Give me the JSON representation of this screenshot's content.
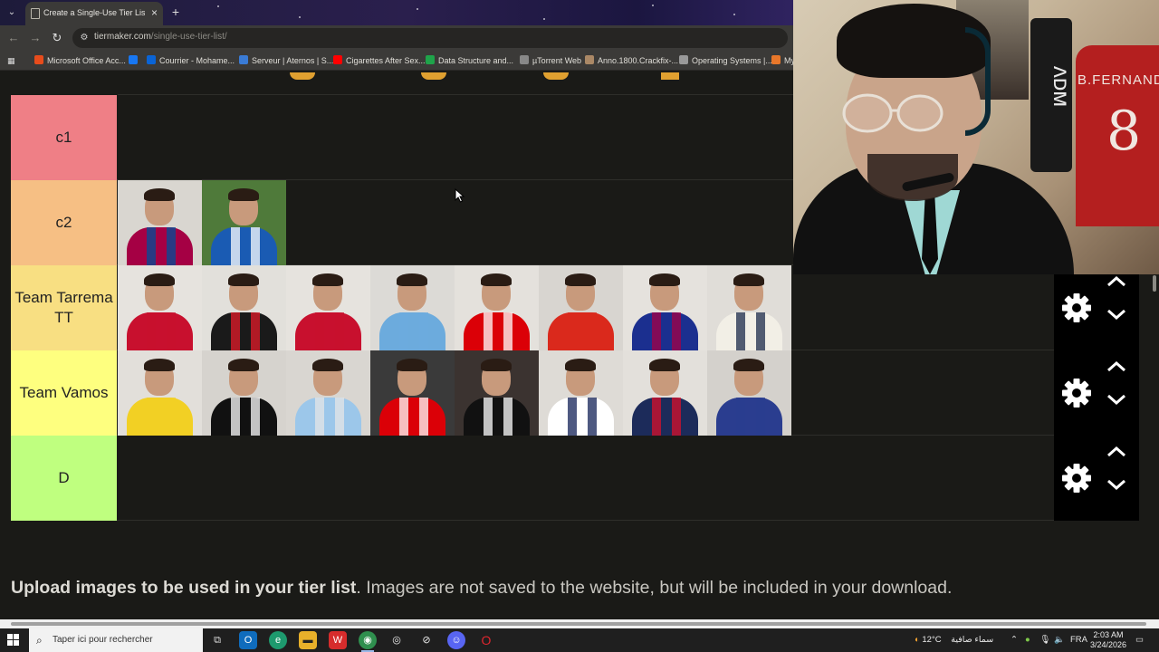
{
  "browser": {
    "tab_title": "Create a Single-Use Tier List (P",
    "url_host": "tiermaker.com",
    "url_path": "/single-use-tier-list/",
    "bookmarks": [
      {
        "label": "Microsoft Office Acc...",
        "color": "#e74c1c"
      },
      {
        "label": "Courrier - Mohame...",
        "color": "#1877f2"
      },
      {
        "label": "Courrier - Mohame...",
        "color": "#0a64d6"
      },
      {
        "label": "Serveur | Aternos | S...",
        "color": "#3a7bd5"
      },
      {
        "label": "Cigarettes After Sex...",
        "color": "#ff0000"
      },
      {
        "label": "Data Structure and...",
        "color": "#1fa34a"
      },
      {
        "label": "µTorrent Web",
        "color": "#888888"
      },
      {
        "label": "Anno.1800.Crackfix-...",
        "color": "#aa8866"
      },
      {
        "label": "Operating Systems |...",
        "color": "#999999"
      },
      {
        "label": "My",
        "color": "#e8772a"
      }
    ]
  },
  "tiers": [
    {
      "label": "c1",
      "color": "#ef7f86",
      "items": []
    },
    {
      "label": "c2",
      "color": "#f6bf84",
      "items": [
        {
          "shirt": "#a50044",
          "stripe": "#004d98",
          "bg": "#d9d6d0"
        },
        {
          "shirt": "#1a5bb3",
          "stripe": "#ffffff",
          "bg": "#4f7a3a"
        }
      ]
    },
    {
      "label": "Team Tarrema TT",
      "color": "#f8df82",
      "items": [
        {
          "shirt": "#c8102e",
          "stripe": "#c8102e",
          "bg": "#e6e3de"
        },
        {
          "shirt": "#1a1a1a",
          "stripe": "#e41b2a",
          "bg": "#e2e0db"
        },
        {
          "shirt": "#c8102e",
          "stripe": "#c8102e",
          "bg": "#e6e3de"
        },
        {
          "shirt": "#6cabdd",
          "stripe": "#6cabdd",
          "bg": "#dcdad6"
        },
        {
          "shirt": "#db0007",
          "stripe": "#ffffff",
          "bg": "#e4e1dc"
        },
        {
          "shirt": "#da291c",
          "stripe": "#da291c",
          "bg": "#d8d5d0"
        },
        {
          "shirt": "#1b2f8f",
          "stripe": "#a50044",
          "bg": "#e5e2dd"
        },
        {
          "shirt": "#f2efe6",
          "stripe": "#1b2a4a",
          "bg": "#e0ddd8"
        }
      ]
    },
    {
      "label": "Team Vamos",
      "color": "#feff7f",
      "items": [
        {
          "shirt": "#f2d024",
          "stripe": "#f2d024",
          "bg": "#e2dfda"
        },
        {
          "shirt": "#111111",
          "stripe": "#ffffff",
          "bg": "#d6d3ce"
        },
        {
          "shirt": "#9cc7ea",
          "stripe": "#e6e6e6",
          "bg": "#d9d6d1"
        },
        {
          "shirt": "#db0007",
          "stripe": "#ffffff",
          "bg": "#3a3a3a"
        },
        {
          "shirt": "#111111",
          "stripe": "#ffffff",
          "bg": "#3b3330"
        },
        {
          "shirt": "#ffffff",
          "stripe": "#132257",
          "bg": "#dedbd6"
        },
        {
          "shirt": "#1c2b5a",
          "stripe": "#d8102b",
          "bg": "#e3e0db"
        },
        {
          "shirt": "#2a3d8f",
          "stripe": "#2a3d8f",
          "bg": "#d4d1cc"
        }
      ]
    },
    {
      "label": "D",
      "color": "#bfff7f",
      "items": []
    }
  ],
  "upload": {
    "bold": "Upload images to be used in your tier list",
    "rest": ". Images are not saved to the website, but will be included in your download."
  },
  "webcam": {
    "jersey_name": "B.FERNANDES",
    "jersey_number": "8"
  },
  "taskbar": {
    "search_placeholder": "Taper ici pour rechercher",
    "weather_temp": "12°C",
    "weather_text": "سماء صافية",
    "lang": "FRA",
    "time": "2:03 AM",
    "date": "3/24/2026"
  }
}
